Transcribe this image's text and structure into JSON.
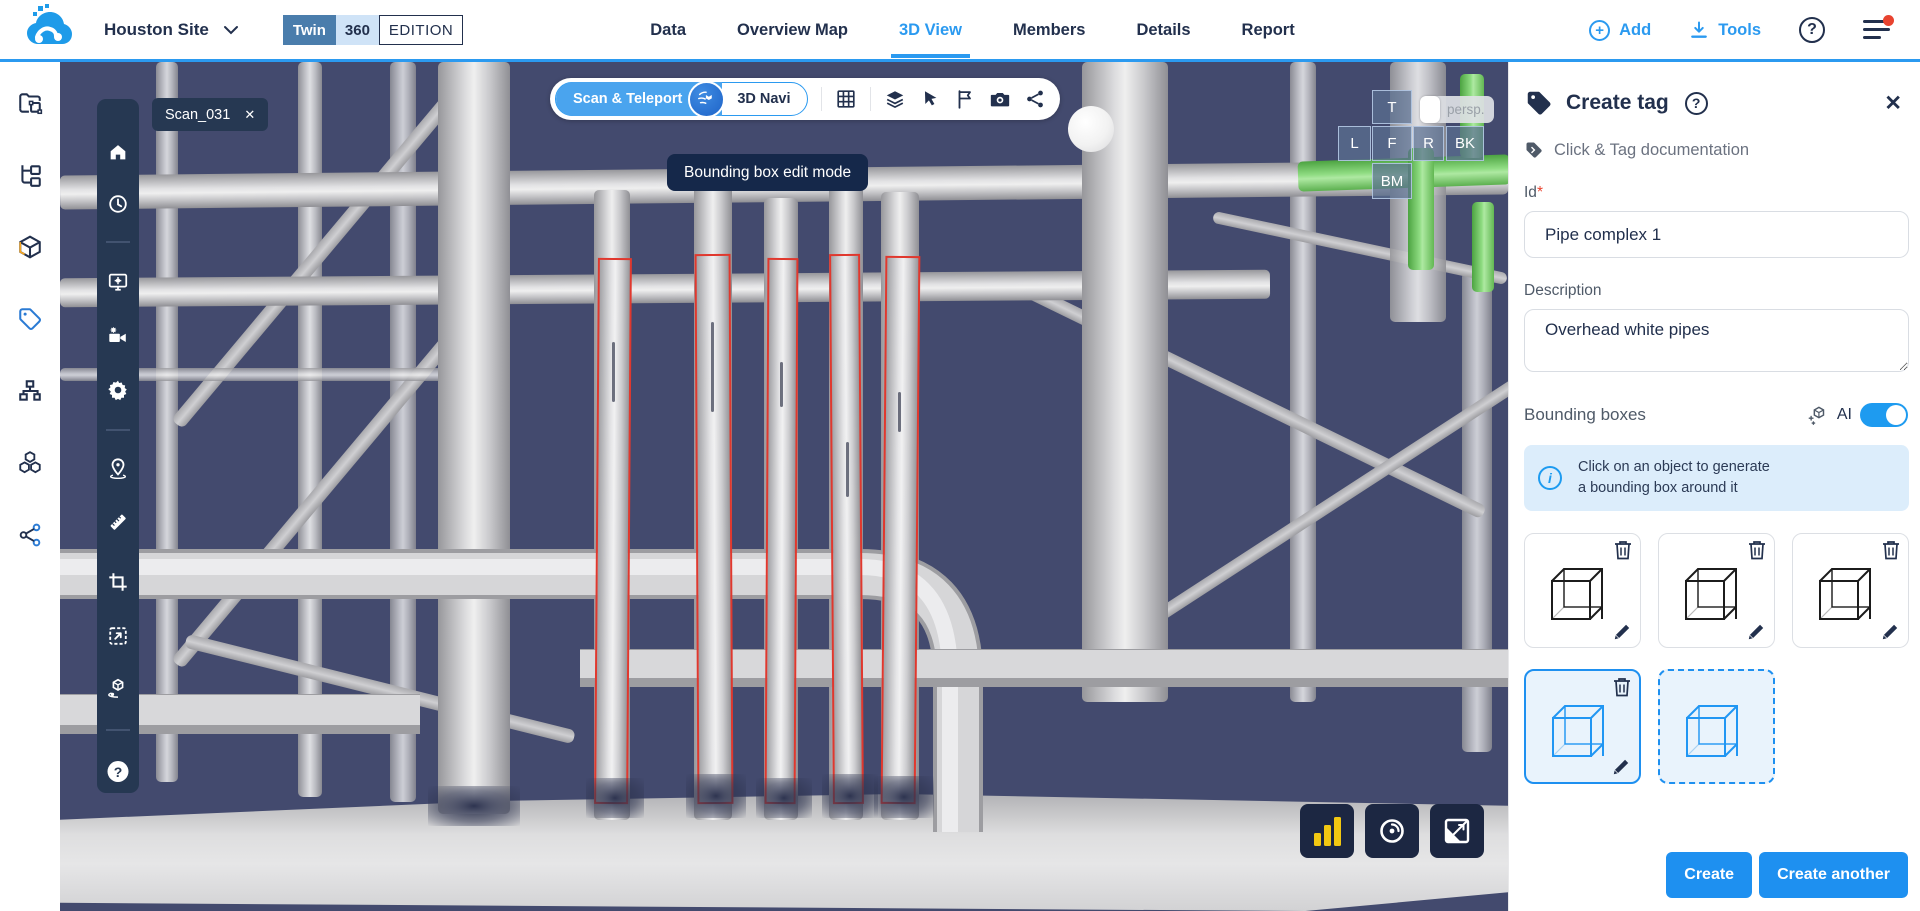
{
  "topbar": {
    "site_name": "Houston Site",
    "badge": {
      "twin": "Twin",
      "num": "360",
      "edition": "EDITION"
    },
    "tabs": [
      {
        "label": "Data",
        "active": false
      },
      {
        "label": "Overview Map",
        "active": false
      },
      {
        "label": "3D View",
        "active": true
      },
      {
        "label": "Members",
        "active": false
      },
      {
        "label": "Details",
        "active": false
      },
      {
        "label": "Report",
        "active": false
      }
    ],
    "actions": {
      "add": "Add",
      "tools": "Tools"
    },
    "icons": [
      "cloud-logo",
      "chevron-down-icon",
      "plus-circle-icon",
      "download-icon",
      "help-icon",
      "menu-icon",
      "notification-dot"
    ]
  },
  "sidebar": {
    "icons": [
      "folder-icon",
      "tree-icon",
      "cube-icon",
      "tag-icon",
      "workflow-icon",
      "cubes-icon",
      "share-icon"
    ]
  },
  "viewport": {
    "scan_chip": "Scan_031",
    "mode_toggle": {
      "left": "Scan & Teleport",
      "right": "3D Navi",
      "active": "Scan & Teleport"
    },
    "toolbar_icons": [
      "grid-icon",
      "layers-icon",
      "cursor-icon",
      "flag-icon",
      "camera-icon",
      "share-icon"
    ],
    "left_toolbar_icons": [
      "home-icon",
      "clock-icon",
      "display-settings-icon",
      "video-settings-icon",
      "gear-icon",
      "location-pin-icon",
      "ruler-icon",
      "crop-icon",
      "image-export-icon",
      "model-place-icon",
      "help-icon"
    ],
    "tooltip": "Bounding box edit mode",
    "viewcube": {
      "top": "T",
      "left": "L",
      "front": "F",
      "right": "R",
      "back": "BK",
      "bottom": "BM",
      "projection": "persp."
    },
    "bottom_icons": [
      "power-bi-icon",
      "compass-icon",
      "minimap-icon"
    ]
  },
  "panel": {
    "title": "Create tag",
    "doc_link": "Click & Tag documentation",
    "id_label": "Id",
    "required_mark": "*",
    "id_value": "Pipe complex 1",
    "description_label": "Description",
    "description_value": "Overhead white pipes",
    "bounding_boxes_label": "Bounding boxes",
    "ai_label": "AI",
    "ai_toggle_on": true,
    "info_line1": "Click on an object to generate",
    "info_line2": "a bounding box around it",
    "bounding_box_cards": [
      {
        "state": "default"
      },
      {
        "state": "default"
      },
      {
        "state": "default"
      },
      {
        "state": "selected"
      },
      {
        "state": "pending"
      }
    ],
    "buttons": {
      "create": "Create",
      "create_another": "Create another"
    }
  },
  "colors": {
    "accent_blue": "#2b9af0",
    "button_blue": "#1e90f0",
    "navy": "#22304d",
    "toolbar_dark": "#263852",
    "tooltip_dark": "#15284a",
    "viewport_bg": "#434a6e",
    "bbox_red": "#e0382e",
    "highlight_green": "#6fcf5a",
    "powerbi_yellow": "#f2c811",
    "info_bg": "#dcedfb"
  }
}
